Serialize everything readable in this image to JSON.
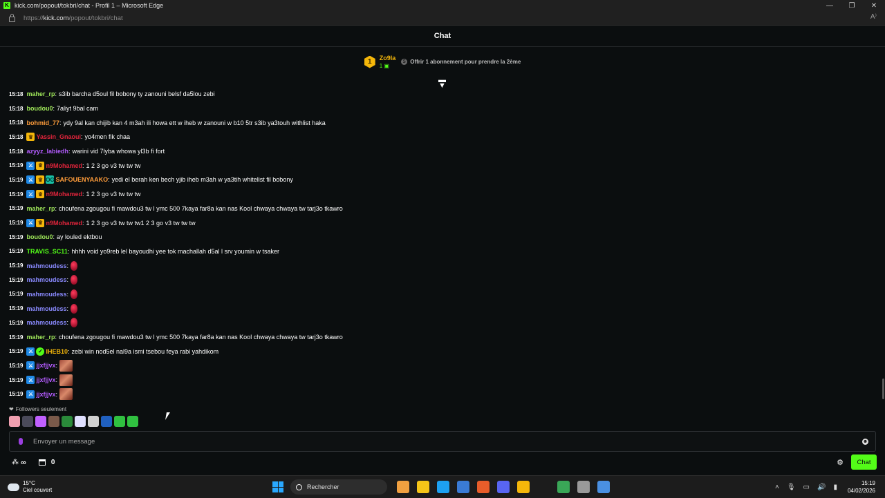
{
  "browser": {
    "title": "kick.com/popout/tokbri/chat - Profil 1 – Microsoft Edge",
    "url_prefix": "https://",
    "url_domain": "kick.com",
    "url_path": "/popout/tokbri/chat",
    "window_controls": {
      "minimize": "—",
      "restore": "❐",
      "close": "✕"
    }
  },
  "chat": {
    "title": "Chat",
    "pinned": {
      "badge_number": "1",
      "username": "Zo9la",
      "gift_count": "1",
      "text": "Offrir 1 abonnement pour prendre la 2ème"
    },
    "messages": [
      {
        "time": "15:18",
        "badges": [],
        "user": "maher_rp",
        "color": "#a0e85a",
        "text": "s3ib barcha d5oul fil bobony ty zanouni belsf da5lou zebi",
        "emote": ""
      },
      {
        "time": "15:18",
        "badges": [],
        "user": "boudou0",
        "color": "#a0e85a",
        "text": "7aliyt 9bal cam",
        "emote": ""
      },
      {
        "time": "15:18",
        "badges": [],
        "user": "bohmid_77",
        "color": "#ff9d3b",
        "text": "ydy 9al kan chijib kan 4 m3ah ili howa ett w iheb w zanouni w b10 5tr s3ib ya3touh withlist haka",
        "emote": ""
      },
      {
        "time": "15:18",
        "badges": [
          "vip"
        ],
        "user": "Yassin_Gnaoui",
        "color": "#e0243b",
        "text": "yo4men fik chaa",
        "emote": ""
      },
      {
        "time": "15:18",
        "badges": [],
        "user": "azyyz_labiedh",
        "color": "#b45cff",
        "text": "warini vid 7lyba whowa yl3b fi fort",
        "emote": ""
      },
      {
        "time": "15:19",
        "badges": [
          "mod",
          "vip"
        ],
        "user": "n9Mohamed",
        "color": "#e0243b",
        "text": "1 2 3 go v3 tw tw tw",
        "emote": ""
      },
      {
        "time": "15:19",
        "badges": [
          "mod",
          "vip",
          "og"
        ],
        "user": "SAFOUENYAAKO",
        "color": "#ff9d3b",
        "text": "yedi el berah ken bech yjib iheb m3ah w ya3tih whitelist fil bobony",
        "emote": ""
      },
      {
        "time": "15:19",
        "badges": [
          "mod",
          "vip"
        ],
        "user": "n9Mohamed",
        "color": "#e0243b",
        "text": "1 2 3 go v3 tw tw tw",
        "emote": ""
      },
      {
        "time": "15:19",
        "badges": [],
        "user": "maher_rp",
        "color": "#a0e85a",
        "text": "choufena zgougou fi mawdou3 tw l ymc 500 7kaya far8a kan nas Kool chwaya chwaya tw tarj3o tkawro",
        "emote": ""
      },
      {
        "time": "15:19",
        "badges": [
          "mod",
          "vip"
        ],
        "user": "n9Mohamed",
        "color": "#e0243b",
        "text": "1 2 3 go v3 tw tw tw1 2 3 go v3 tw tw tw",
        "emote": ""
      },
      {
        "time": "15:19",
        "badges": [],
        "user": "boudou0",
        "color": "#a0e85a",
        "text": "ay louled ektbou",
        "emote": ""
      },
      {
        "time": "15:19",
        "badges": [],
        "user": "TRAVIS_SC11",
        "color": "#53fc18",
        "text": "hhhh void yo9reb lel bayoudhi yee tok machallah d5al l srv youmin w tsaker",
        "emote": ""
      },
      {
        "time": "15:19",
        "badges": [],
        "user": "mahmoudess",
        "color": "#8a8aff",
        "text": "",
        "emote": "red"
      },
      {
        "time": "15:19",
        "badges": [],
        "user": "mahmoudess",
        "color": "#8a8aff",
        "text": "",
        "emote": "red"
      },
      {
        "time": "15:19",
        "badges": [],
        "user": "mahmoudess",
        "color": "#8a8aff",
        "text": "",
        "emote": "red"
      },
      {
        "time": "15:19",
        "badges": [],
        "user": "mahmoudess",
        "color": "#8a8aff",
        "text": "",
        "emote": "red"
      },
      {
        "time": "15:19",
        "badges": [],
        "user": "mahmoudess",
        "color": "#8a8aff",
        "text": "",
        "emote": "red"
      },
      {
        "time": "15:19",
        "badges": [],
        "user": "maher_rp",
        "color": "#a0e85a",
        "text": "choufena zgougou fi mawdou3 tw l ymc 500 7kaya far8a kan nas Kool chwaya chwaya tw tarj3o tkawro",
        "emote": ""
      },
      {
        "time": "15:19",
        "badges": [
          "mod",
          "verified"
        ],
        "user": "IHEB10",
        "color": "#f5b70a",
        "text": "zebi win nod5el nal9a ismi tsebou feya rabi yahdikom",
        "emote": ""
      },
      {
        "time": "15:19",
        "badges": [
          "mod"
        ],
        "user": "jjxfjjvx",
        "color": "#b45cff",
        "text": "",
        "emote": "face"
      },
      {
        "time": "15:19",
        "badges": [
          "mod"
        ],
        "user": "jjxfjjvx",
        "color": "#b45cff",
        "text": "",
        "emote": "face"
      },
      {
        "time": "15:19",
        "badges": [
          "mod"
        ],
        "user": "jjxfjjvx",
        "color": "#b45cff",
        "text": "",
        "emote": "face"
      }
    ],
    "followers_only": "Followers seulement",
    "emote_bar": [
      "#f0a0b0",
      "#4a4a5a",
      "#c060ff",
      "#7a5a4a",
      "#2a8a3a",
      "#e0e0ff",
      "#d0d0d0",
      "#2060c0",
      "#30c040",
      "#30c040"
    ],
    "input_placeholder": "Envoyer un message",
    "points_symbol": "∞",
    "store_count": "0",
    "send_button": "Chat"
  },
  "taskbar": {
    "temperature": "15°C",
    "weather": "Ciel couvert",
    "search_label": "Rechercher",
    "apps": [
      "#f0a040",
      "#f5c518",
      "#1da1f2",
      "#3a7bd5",
      "#e85d2a",
      "#5865f2",
      "#f5b70a",
      "#1c1c1c",
      "#3aa757",
      "#9a9a9a",
      "#4a90e2"
    ],
    "time": "15:19",
    "date": "04/02/2026"
  }
}
